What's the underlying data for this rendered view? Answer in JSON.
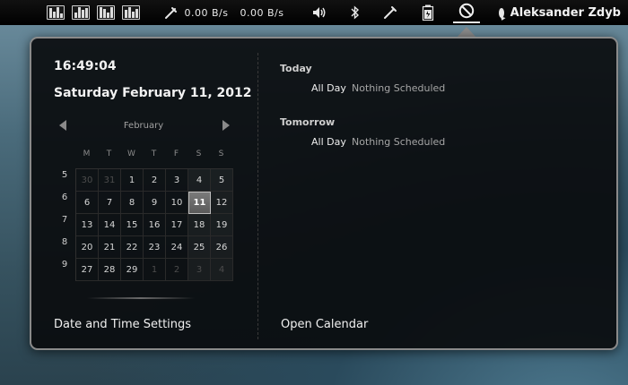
{
  "top_bar": {
    "monitors": [
      "cpu-monitor-icon",
      "memory-monitor-icon",
      "swap-monitor-icon",
      "network-monitor-icon"
    ],
    "net_down": "0.00 B/s",
    "net_up": "0.00 B/s",
    "icons": [
      "network-icon",
      "volume-icon",
      "bluetooth-icon",
      "pen-icon",
      "battery-icon",
      "clock-icon"
    ],
    "user_name": "Aleksander Zdyb"
  },
  "clock": {
    "time": "16:49:04",
    "date": "Saturday February 11, 2012"
  },
  "calendar": {
    "month": "February",
    "weekdays": [
      "M",
      "T",
      "W",
      "T",
      "F",
      "S",
      "S"
    ],
    "week_numbers": [
      "5",
      "6",
      "7",
      "8",
      "9"
    ],
    "weeks": [
      [
        "30",
        "31",
        "1",
        "2",
        "3",
        "4",
        "5"
      ],
      [
        "6",
        "7",
        "8",
        "9",
        "10",
        "11",
        "12"
      ],
      [
        "13",
        "14",
        "15",
        "16",
        "17",
        "18",
        "19"
      ],
      [
        "20",
        "21",
        "22",
        "23",
        "24",
        "25",
        "26"
      ],
      [
        "27",
        "28",
        "29",
        "1",
        "2",
        "3",
        "4"
      ]
    ],
    "selected_day": "11"
  },
  "events": {
    "today_heading": "Today",
    "today_time": "All Day",
    "today_desc": "Nothing Scheduled",
    "tomorrow_heading": "Tomorrow",
    "tomorrow_time": "All Day",
    "tomorrow_desc": "Nothing Scheduled"
  },
  "links": {
    "date_time_settings": "Date and Time Settings",
    "open_calendar": "Open Calendar"
  }
}
